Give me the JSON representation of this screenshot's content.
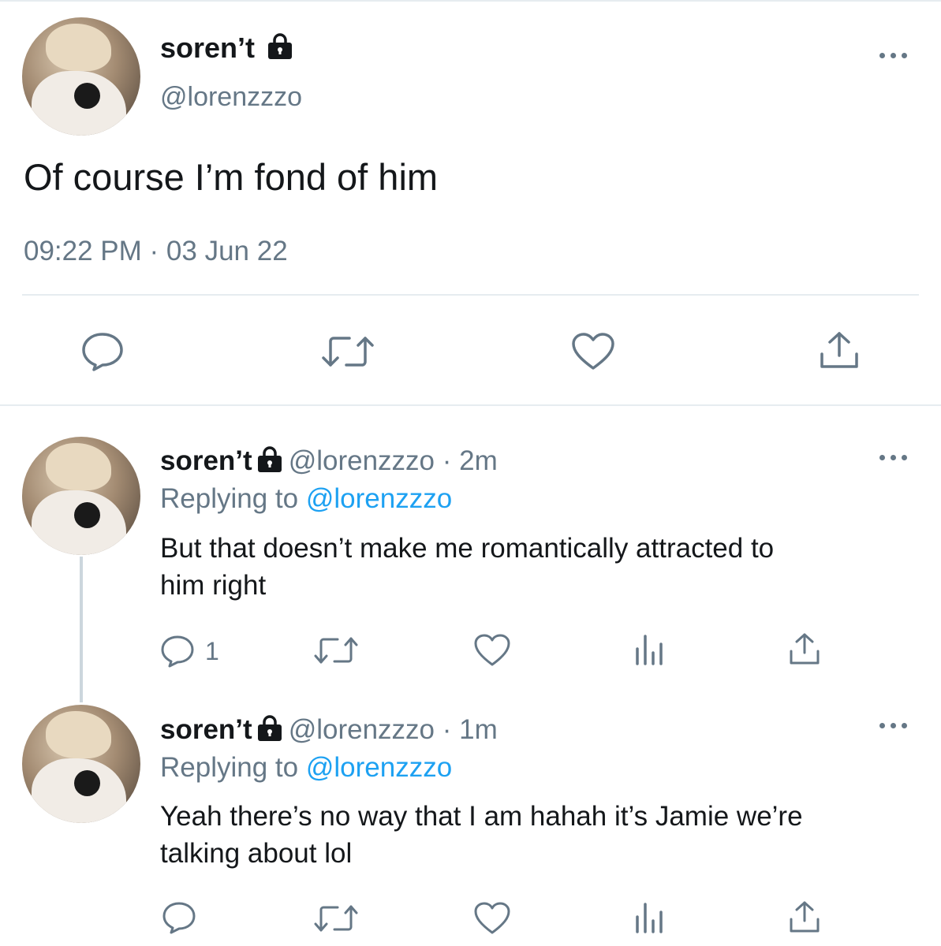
{
  "main_tweet": {
    "display_name": "soren’t",
    "handle": "@lorenzzzo",
    "text": "Of course I’m fond of him",
    "timestamp": "09:22 PM · 03 Jun 22"
  },
  "replies": [
    {
      "display_name": "soren’t",
      "handle": "@lorenzzzo",
      "time_ago": "· 2m",
      "replying_label": "Replying to",
      "replying_handle": "@lorenzzzo",
      "text_line1": "But that doesn’t make me romantically attracted to",
      "text_line2": "him right",
      "reply_count": "1"
    },
    {
      "display_name": "soren’t",
      "handle": "@lorenzzzo",
      "time_ago": "· 1m",
      "replying_label": "Replying to",
      "replying_handle": "@lorenzzzo",
      "text_line1": "Yeah there’s no way that I am hahah it’s Jamie we’re",
      "text_line2": "talking about lol",
      "reply_count": ""
    }
  ],
  "icons": [
    "comment-icon",
    "retweet-icon",
    "like-icon",
    "share-icon",
    "analytics-icon",
    "lock-icon",
    "more-icon"
  ],
  "colors": {
    "text": "#14171a",
    "muted": "#657786",
    "link": "#1da1f2",
    "divider": "#e6ecf0"
  }
}
